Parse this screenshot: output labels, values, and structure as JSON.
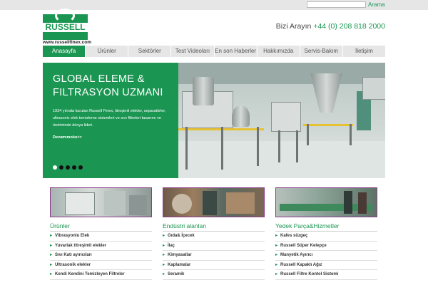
{
  "search": {
    "placeholder": "",
    "button_label": "Arama"
  },
  "brand": {
    "logo_text": "RUSSELL",
    "url_text": "www.russellfinex.com"
  },
  "contact": {
    "label": "Bizi Arayın",
    "phone": "+44 (0) 208 818 2000"
  },
  "nav": {
    "items": [
      {
        "label": "Anasayfa",
        "active": true
      },
      {
        "label": "Ürünler",
        "active": false
      },
      {
        "label": "Sektörler",
        "active": false
      },
      {
        "label": "Test Videoları",
        "active": false
      },
      {
        "label": "En son Haberler",
        "active": false
      },
      {
        "label": "Hakkımızda",
        "active": false
      },
      {
        "label": "Servis-Bakım",
        "active": false
      },
      {
        "label": "İletişim",
        "active": false
      }
    ]
  },
  "hero": {
    "title": "GLOBAL ELEME & FILTRASYON UZMANI",
    "description": "1934 yılında kurulan Russell Finex, titreşimli elekler, separatörler, ultrasonic elek temizleme sistemleri ve sıvı filtreleri tasarımı ve üretiminde dünya lideri.",
    "more_link": "Devamınıoku>>",
    "slide_count": 5,
    "active_slide": 1
  },
  "columns": [
    {
      "title": "Ürünler",
      "items": [
        "Vibrasyonlu Elek",
        "Yuvarlak titreşimli elekler",
        "Sıvı Katı ayırıcıları",
        "Ultrasonik elekler",
        "Kendi Kendini Temizleyen Filtreler"
      ]
    },
    {
      "title": "Endüstri alanları",
      "items": [
        "Gıda& İçecek",
        "İlaç",
        "Kimyasallar",
        "Kaplamalar",
        "Seramik"
      ]
    },
    {
      "title": "Yedek Parça&Hizmetler",
      "items": [
        "Kafes süzgeç",
        "Russell Süper Kelepçe",
        "Manyetik Ayırıcı",
        "Russell Kapaklı Ağız",
        "Russell Filtre Kontol Sistemi"
      ]
    }
  ],
  "colors": {
    "brand_green": "#1b9652",
    "thumb_border": "#8a3b8a"
  }
}
